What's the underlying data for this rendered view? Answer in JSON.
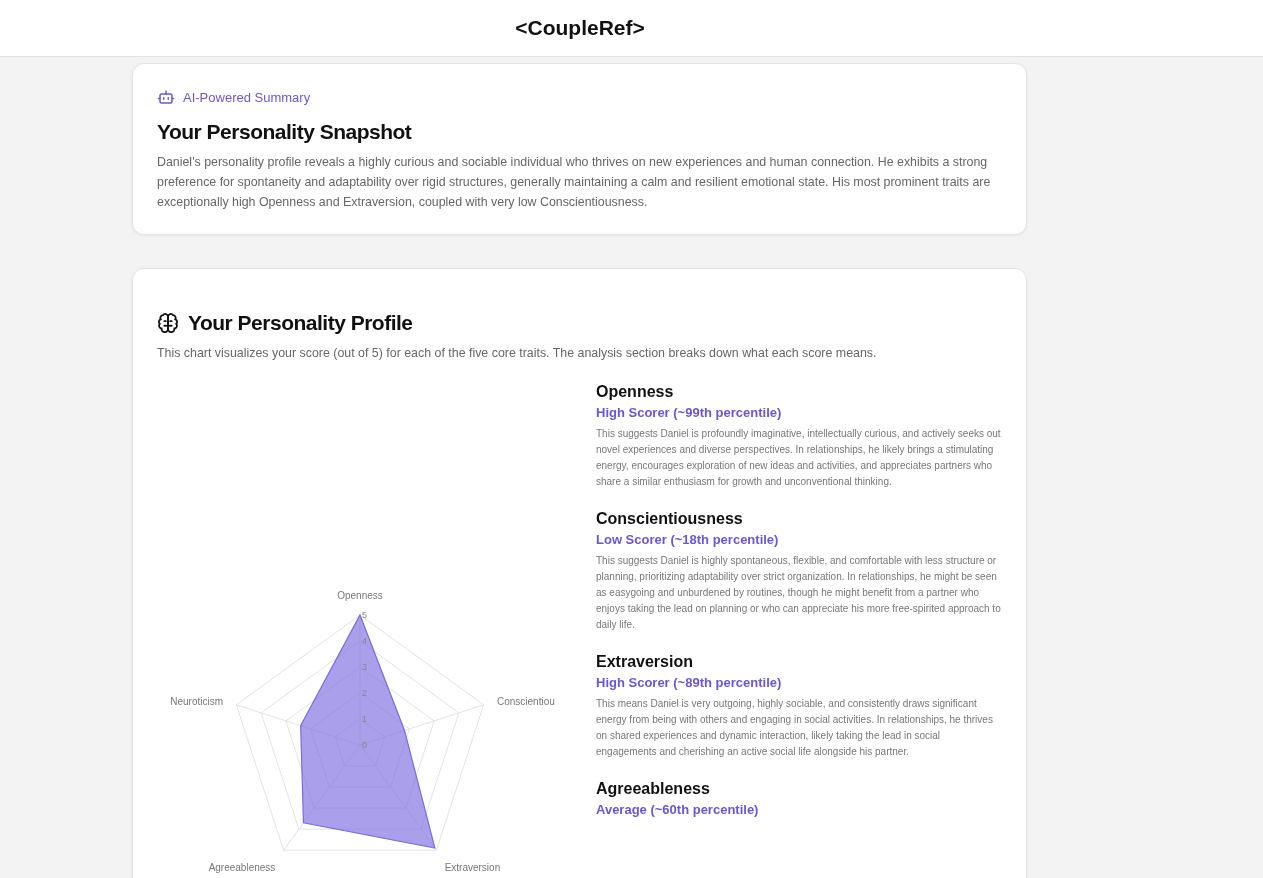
{
  "header": {
    "title": "<CoupleRef>"
  },
  "summary": {
    "badge": "AI-Powered Summary",
    "title": "Your Personality Snapshot",
    "text": "Daniel's personality profile reveals a highly curious and sociable individual who thrives on new experiences and human connection. He exhibits a strong preference for spontaneity and adaptability over rigid structures, generally maintaining a calm and resilient emotional state. His most prominent traits are exceptionally high Openness and Extraversion, coupled with very low Conscientiousness."
  },
  "profile": {
    "title": "Your Personality Profile",
    "intro": "This chart visualizes your score (out of 5) for each of the five core traits. The analysis section breaks down what each score means.",
    "chart_data": {
      "type": "radar",
      "categories": [
        "Openness",
        "Conscientiou",
        "Extraversion",
        "Agreeableness",
        "Neuroticism"
      ],
      "series": [
        {
          "color": "#7b6be0",
          "values": [
            5,
            1.8,
            4.9,
            3.7,
            2.4
          ]
        }
      ],
      "ylim": [
        0,
        5
      ],
      "yticks": [
        0,
        1,
        2,
        3,
        4,
        5
      ]
    },
    "traits": [
      {
        "name": "Openness",
        "score": "High Scorer (~99th percentile)",
        "text": "This suggests Daniel is profoundly imaginative, intellectually curious, and actively seeks out novel experiences and diverse perspectives. In relationships, he likely brings a stimulating energy, encourages exploration of new ideas and activities, and appreciates partners who share a similar enthusiasm for growth and unconventional thinking."
      },
      {
        "name": "Conscientiousness",
        "score": "Low Scorer (~18th percentile)",
        "text": "This suggests Daniel is highly spontaneous, flexible, and comfortable with less structure or planning, prioritizing adaptability over strict organization. In relationships, he might be seen as easygoing and unburdened by routines, though he might benefit from a partner who enjoys taking the lead on planning or who can appreciate his more free-spirited approach to daily life."
      },
      {
        "name": "Extraversion",
        "score": "High Scorer (~89th percentile)",
        "text": "This means Daniel is very outgoing, highly sociable, and consistently draws significant energy from being with others and engaging in social activities. In relationships, he thrives on shared experiences and dynamic interaction, likely taking the lead in social engagements and cherishing an active social life alongside his partner."
      },
      {
        "name": "Agreeableness",
        "score": "Average (~60th percentile)"
      }
    ]
  }
}
